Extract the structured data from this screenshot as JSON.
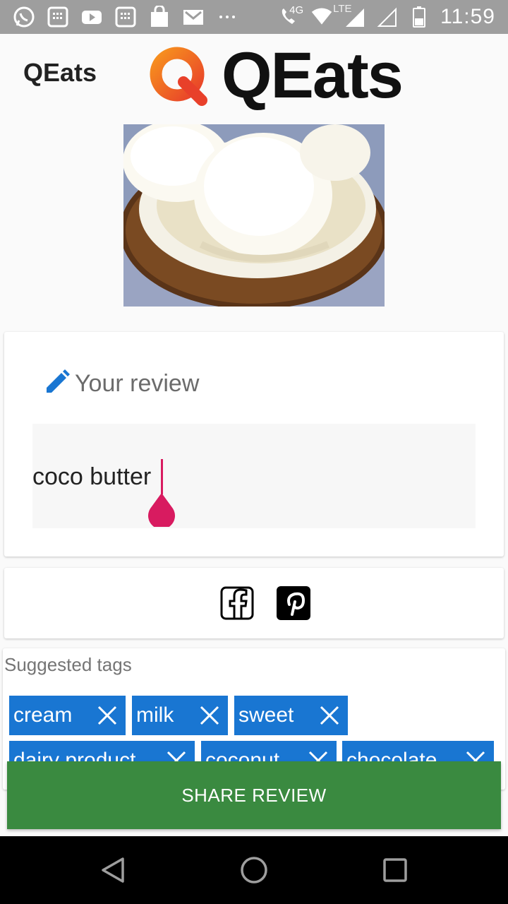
{
  "status_bar": {
    "network": "4G",
    "lte": "LTE",
    "time": "11:59",
    "icons": [
      "whatsapp-icon",
      "sim-toolkit-icon",
      "youtube-icon",
      "sim-toolkit-icon",
      "shopping-bag-icon",
      "gmail-icon",
      "more-dots-icon",
      "volte-call-icon",
      "wifi-icon",
      "signal-icon",
      "signal-empty-icon",
      "battery-icon"
    ]
  },
  "app_bar": {
    "title": "QEats",
    "logo_letter": "Q",
    "logo_text": "QEats"
  },
  "review": {
    "heading": "Your review",
    "text": "coco butter",
    "icon": "pencil-icon"
  },
  "share_icons": [
    "facebook-icon",
    "pinterest-icon"
  ],
  "tags": {
    "title": "Suggested tags",
    "items": [
      "cream",
      "milk",
      "sweet",
      "dairy product",
      "coconut",
      "chocolate"
    ]
  },
  "share_button": {
    "label": "SHARE REVIEW"
  },
  "colors": {
    "tag_chip": "#1976d2",
    "share_button": "#3a8a40",
    "accent": "#d81b60",
    "logo_orange": "#f05a28"
  }
}
